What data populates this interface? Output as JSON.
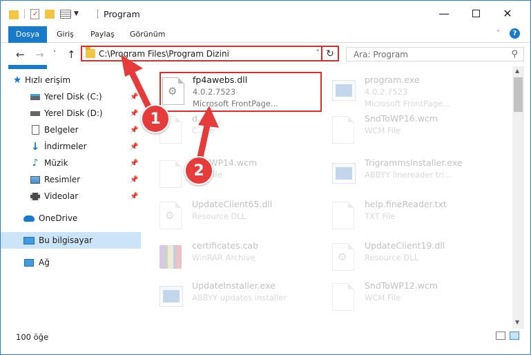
{
  "window": {
    "title": "Program",
    "title_icon": "folder-icon",
    "colors": {
      "accent": "#1979ca",
      "highlight": "#e02b2b",
      "selected": "#cce4f7"
    }
  },
  "ribbon": {
    "tabs": [
      "Dosya",
      "Giriş",
      "Paylaş",
      "Görünüm"
    ]
  },
  "address": {
    "path": "C:\\Program Files\\Program Dizini",
    "search_placeholder": "Ara: Program"
  },
  "nav": {
    "quick_access": "Hızlı erişim",
    "items": [
      {
        "label": "Yerel Disk (C:)",
        "icon": "drive-icon",
        "pinned": true
      },
      {
        "label": "Yerel Disk (D:)",
        "icon": "drive-icon",
        "pinned": true
      },
      {
        "label": "Belgeler",
        "icon": "documents-icon",
        "pinned": true
      },
      {
        "label": "İndirmeler",
        "icon": "download-icon",
        "pinned": true
      },
      {
        "label": "Müzik",
        "icon": "music-icon",
        "pinned": true
      },
      {
        "label": "Resimler",
        "icon": "pictures-icon",
        "pinned": true
      },
      {
        "label": "Videolar",
        "icon": "videos-icon",
        "pinned": true
      }
    ],
    "onedrive": "OneDrive",
    "this_pc": "Bu bilgisayar",
    "network": "Ağ"
  },
  "files": {
    "left": [
      {
        "name": "fp4awebs.dll",
        "line1": "4.0.2.7523",
        "line2": "Microsoft FrontPage...",
        "icon": "dll-icon"
      },
      {
        "name": "d...A",
        "line1": "C...ile",
        "line2": "",
        "icon": "document-icon"
      },
      {
        "name": "...ToWP14.wcm",
        "line1": "...M File",
        "line2": "",
        "icon": "document-icon"
      },
      {
        "name": "UpdateClient65.dll",
        "line1": "Resource DLL",
        "line2": "",
        "icon": "dll-icon"
      },
      {
        "name": "certificates.cab",
        "line1": "WinRAR Archive",
        "line2": "",
        "icon": "archive-icon"
      },
      {
        "name": "UpdateInstaller.exe",
        "line1": "ABBYY updates installer",
        "line2": "",
        "icon": "app-icon"
      }
    ],
    "right": [
      {
        "name": "program.exe",
        "line1": "4.0.2.7523",
        "line2": "Microsoft FrontPage...",
        "icon": "app-icon"
      },
      {
        "name": "SndToWP16.wcm",
        "line1": "WCM File",
        "line2": "",
        "icon": "document-icon"
      },
      {
        "name": "TrigrammsInstaller.exe",
        "line1": "ABBYY linereader tri...",
        "line2": "",
        "icon": "app-icon"
      },
      {
        "name": "help.fineReader.txt",
        "line1": "TXT File",
        "line2": "",
        "icon": "document-icon"
      },
      {
        "name": "UpdateClient19.dll",
        "line1": "Resource DLL",
        "line2": "",
        "icon": "dll-icon"
      },
      {
        "name": "SndToWP12.wcm",
        "line1": "WCM File",
        "line2": "",
        "icon": "document-icon"
      }
    ]
  },
  "status": {
    "count": "100 öğe"
  },
  "annotations": {
    "step1": "1",
    "step2": "2"
  }
}
